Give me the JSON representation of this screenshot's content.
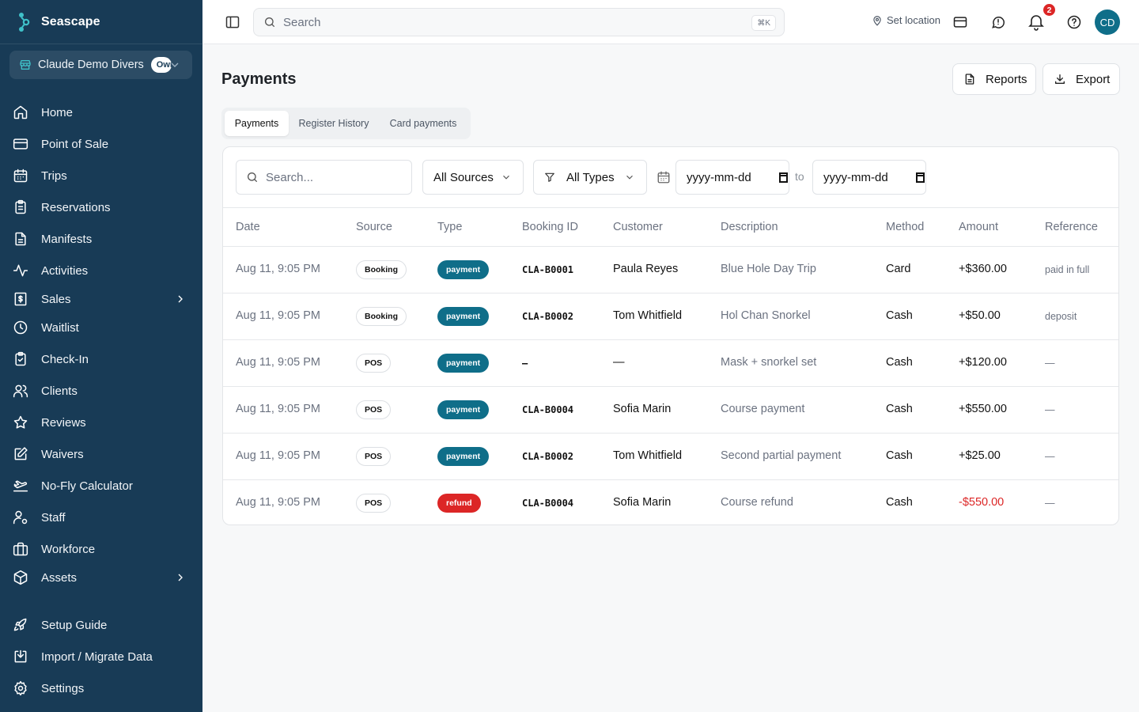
{
  "brand": {
    "name": "Seascape"
  },
  "org": {
    "name": "Claude Demo Divers",
    "badge": "Owner"
  },
  "sidebar": {
    "items": [
      {
        "label": "Home",
        "icon": "home-icon"
      },
      {
        "label": "Point of Sale",
        "icon": "credit-card-icon"
      },
      {
        "label": "Trips",
        "icon": "calendar-icon"
      },
      {
        "label": "Reservations",
        "icon": "clipboard-icon"
      },
      {
        "label": "Manifests",
        "icon": "file-text-icon"
      },
      {
        "label": "Activities",
        "icon": "activity-icon"
      },
      {
        "label": "Sales",
        "icon": "receipt-icon",
        "expandable": true
      },
      {
        "label": "Waitlist",
        "icon": "clock-icon"
      },
      {
        "label": "Check-In",
        "icon": "clipboard-check-icon"
      },
      {
        "label": "Clients",
        "icon": "users-icon"
      },
      {
        "label": "Reviews",
        "icon": "star-icon"
      },
      {
        "label": "Waivers",
        "icon": "edit-icon"
      },
      {
        "label": "No-Fly Calculator",
        "icon": "plane-icon"
      },
      {
        "label": "Staff",
        "icon": "user-cog-icon"
      },
      {
        "label": "Workforce",
        "icon": "briefcase-icon"
      },
      {
        "label": "Assets",
        "icon": "box-icon",
        "expandable": true
      },
      {
        "label": "Setup Guide",
        "icon": "rocket-icon"
      },
      {
        "label": "Import / Migrate Data",
        "icon": "import-icon"
      },
      {
        "label": "Settings",
        "icon": "gear-icon"
      }
    ]
  },
  "topbar": {
    "search_placeholder": "Search",
    "shortcut": "⌘K",
    "location_label": "Set location",
    "notification_count": "2",
    "avatar_initials": "CD"
  },
  "page": {
    "title": "Payments",
    "reports_label": "Reports",
    "export_label": "Export",
    "tabs": [
      {
        "label": "Payments",
        "active": true
      },
      {
        "label": "Register History",
        "active": false
      },
      {
        "label": "Card payments",
        "active": false
      }
    ]
  },
  "filters": {
    "search_placeholder": "Search...",
    "source": "All Sources",
    "type": "All Types",
    "date_from": "yyyy-mm-dd",
    "to_label": "to",
    "date_to": "yyyy-mm-dd"
  },
  "table": {
    "columns": [
      "Date",
      "Source",
      "Type",
      "Booking ID",
      "Customer",
      "Description",
      "Method",
      "Amount",
      "Reference"
    ],
    "rows": [
      {
        "date": "Aug 11, 9:05 PM",
        "source": "Booking",
        "type": "payment",
        "booking_id": "CLA-B0001",
        "customer": "Paula Reyes",
        "description": "Blue Hole Day Trip",
        "method": "Card",
        "amount": "+$360.00",
        "reference": "paid in full"
      },
      {
        "date": "Aug 11, 9:05 PM",
        "source": "Booking",
        "type": "payment",
        "booking_id": "CLA-B0002",
        "customer": "Tom Whitfield",
        "description": "Hol Chan Snorkel",
        "method": "Cash",
        "amount": "+$50.00",
        "reference": "deposit"
      },
      {
        "date": "Aug 11, 9:05 PM",
        "source": "POS",
        "type": "payment",
        "booking_id": "–",
        "customer": "—",
        "description": "Mask + snorkel set",
        "method": "Cash",
        "amount": "+$120.00",
        "reference": "—"
      },
      {
        "date": "Aug 11, 9:05 PM",
        "source": "POS",
        "type": "payment",
        "booking_id": "CLA-B0004",
        "customer": "Sofia Marin",
        "description": "Course payment",
        "method": "Cash",
        "amount": "+$550.00",
        "reference": "—"
      },
      {
        "date": "Aug 11, 9:05 PM",
        "source": "POS",
        "type": "payment",
        "booking_id": "CLA-B0002",
        "customer": "Tom Whitfield",
        "description": "Second partial payment",
        "method": "Cash",
        "amount": "+$25.00",
        "reference": "—"
      },
      {
        "date": "Aug 11, 9:05 PM",
        "source": "POS",
        "type": "refund",
        "booking_id": "CLA-B0004",
        "customer": "Sofia Marin",
        "description": "Course refund",
        "method": "Cash",
        "amount": "-$550.00",
        "reference": "—"
      }
    ]
  },
  "colors": {
    "sidebar_bg": "#183b56",
    "accent": "#0f6e89",
    "payment_badge": "#0f6e89",
    "refund_badge": "#dc2626",
    "negative_amount": "#dc2626"
  }
}
